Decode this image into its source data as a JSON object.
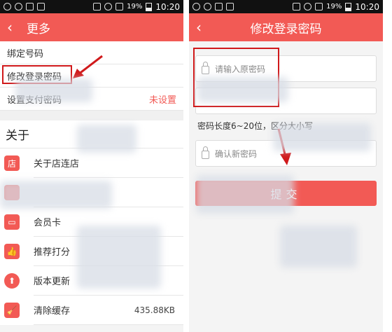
{
  "status": {
    "battery": "19%",
    "time": "10:20"
  },
  "left_screen": {
    "back_glyph": "‹",
    "title": "更多",
    "rows": [
      {
        "label": "绑定号码",
        "value": ""
      },
      {
        "label": "修改登录密码",
        "value": ""
      },
      {
        "label": "设置支付密码",
        "value": "未设置"
      }
    ],
    "about_title": "关于",
    "items": [
      {
        "icon": "store-icon",
        "glyph": "店",
        "label": "关于店连店",
        "extra": ""
      },
      {
        "icon": "hidden-icon",
        "glyph": "",
        "label": "",
        "extra": ""
      },
      {
        "icon": "card-icon",
        "glyph": "▭",
        "label": "会员卡",
        "extra": ""
      },
      {
        "icon": "thumbs-up-icon",
        "glyph": "👍",
        "label": "推荐打分",
        "extra": ""
      },
      {
        "icon": "update-icon",
        "glyph": "⬆",
        "label": "版本更新",
        "extra": ""
      },
      {
        "icon": "broom-icon",
        "glyph": "🧹",
        "label": "清除缓存",
        "extra": "435.88KB"
      }
    ]
  },
  "right_screen": {
    "back_glyph": "‹",
    "title": "修改登录密码",
    "old_password_placeholder": "请输入原密码",
    "new_password_placeholder": "",
    "hint": "密码长度6~20位，区分大小写",
    "confirm_placeholder": "确认新密码",
    "submit_label": "提交"
  },
  "colors": {
    "accent": "#f25a55",
    "highlight": "#d0191b"
  }
}
